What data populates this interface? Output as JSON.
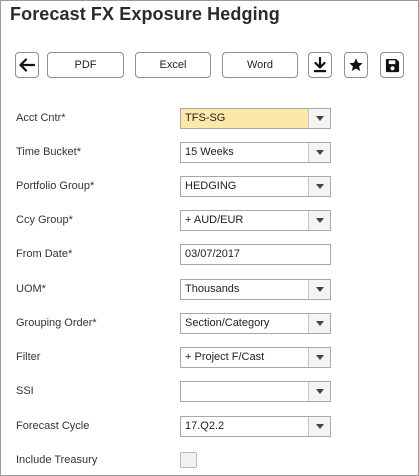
{
  "app": {
    "title": "Forecast FX Exposure Hedging"
  },
  "toolbar": {
    "back_icon": "arrow-left-icon",
    "pdf_label": "PDF",
    "excel_label": "Excel",
    "word_label": "Word",
    "download_icon": "download-icon",
    "favorite_icon": "star-icon",
    "save_icon": "floppy-disk-icon"
  },
  "form": {
    "acct_cntr": {
      "label": "Acct Cntr*",
      "value": "TFS-SG"
    },
    "time_bucket": {
      "label": "Time Bucket*",
      "value": "15 Weeks"
    },
    "portfolio_group": {
      "label": "Portfolio Group*",
      "value": "HEDGING"
    },
    "ccy_group": {
      "label": "Ccy Group*",
      "value": "+ AUD/EUR"
    },
    "from_date": {
      "label": "From Date*",
      "value": "03/07/2017"
    },
    "uom": {
      "label": "UOM*",
      "value": "Thousands"
    },
    "grouping_order": {
      "label": "Grouping Order*",
      "value": "Section/Category"
    },
    "filter": {
      "label": "Filter",
      "value": "+ Project F/Cast"
    },
    "ssi": {
      "label": "SSI",
      "value": ""
    },
    "forecast_cycle": {
      "label": "Forecast Cycle",
      "value": "17.Q2.2"
    },
    "include_treasury": {
      "label": "Include Treasury",
      "checked": false
    }
  },
  "colors": {
    "highlight_field": "#fde9a7",
    "border": "#a8a8a8"
  }
}
